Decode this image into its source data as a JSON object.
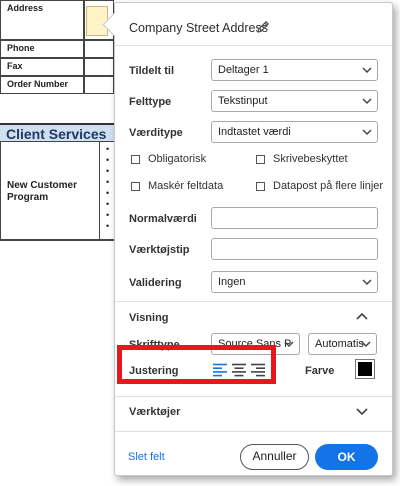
{
  "document": {
    "labels": [
      "Address",
      "Phone",
      "Fax",
      "Order Number"
    ],
    "section_header": "Client Services",
    "program_label": "New Customer Program"
  },
  "panel": {
    "title": "Company Street Address",
    "fields": {
      "assigned_to": {
        "label": "Tildelt til",
        "value": "Deltager 1"
      },
      "field_type": {
        "label": "Felttype",
        "value": "Tekstinput"
      },
      "value_type": {
        "label": "Værditype",
        "value": "Indtastet værdi"
      }
    },
    "checkboxes": [
      {
        "label": "Obligatorisk",
        "checked": false
      },
      {
        "label": "Skrivebeskyttet",
        "checked": false
      },
      {
        "label": "Maskér feltdata",
        "checked": false
      },
      {
        "label": "Datapost på flere linjer",
        "checked": false
      }
    ],
    "default_value": {
      "label": "Normalværdi",
      "value": ""
    },
    "tooltip": {
      "label": "Værktøjstip",
      "value": ""
    },
    "validation": {
      "label": "Validering",
      "value": "Ingen"
    },
    "display": {
      "section_label": "Visning",
      "font_label": "Skrifttype",
      "font_value": "Source Sans P",
      "size_value": "Automatis",
      "alignment_label": "Justering",
      "alignment_selected": "left",
      "color_label": "Farve",
      "color_value": "#000000"
    },
    "tools": {
      "section_label": "Værktøjer"
    },
    "buttons": {
      "delete": "Slet felt",
      "cancel": "Annuller",
      "ok": "OK"
    }
  },
  "colors": {
    "accent": "#1473e6",
    "highlight_box": "#e8161d"
  }
}
